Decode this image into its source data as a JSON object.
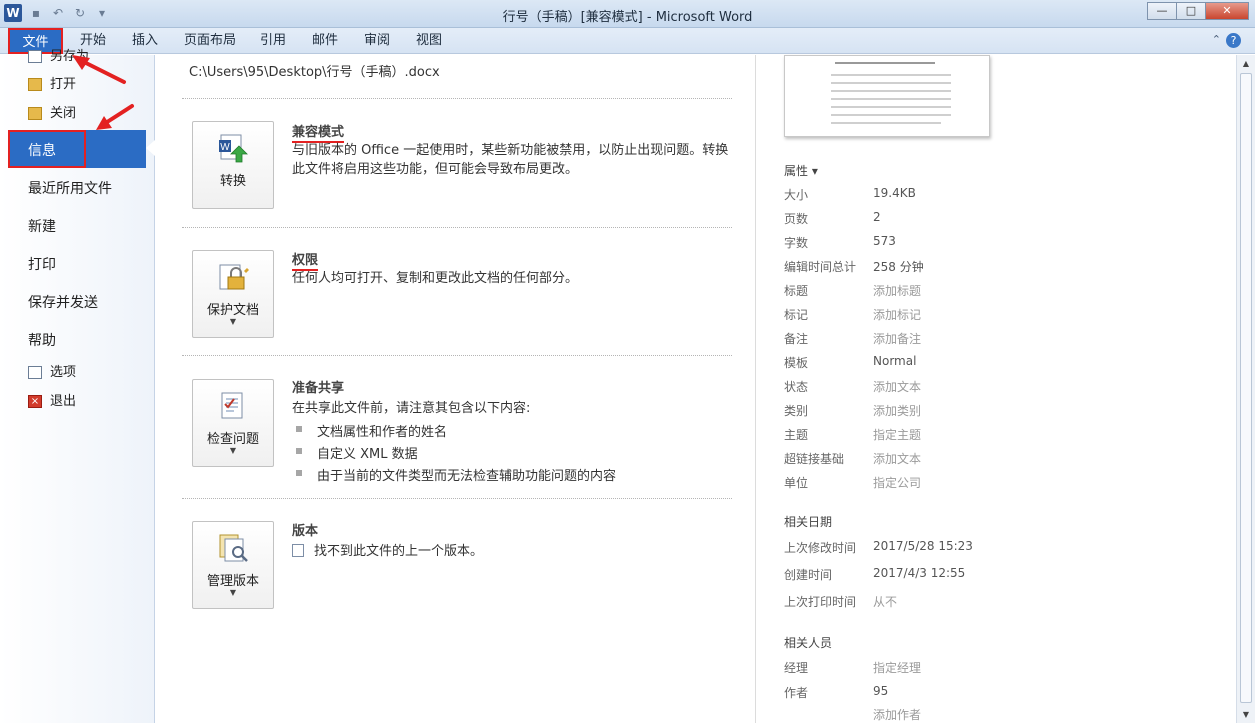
{
  "window": {
    "title": "行号（手稿）[兼容模式] - Microsoft Word",
    "logo": "W",
    "buttons": {
      "minimize": "—",
      "maximize": "□",
      "close": "✕"
    }
  },
  "ribbon": {
    "tabs": [
      "文件",
      "开始",
      "插入",
      "页面布局",
      "引用",
      "邮件",
      "审阅",
      "视图"
    ],
    "help": "?"
  },
  "nav": {
    "save_as": "另存为",
    "open": "打开",
    "close": "关闭",
    "info": "信息",
    "recent": "最近所用文件",
    "new": "新建",
    "print": "打印",
    "save_send": "保存并发送",
    "help": "帮助",
    "options": "选项",
    "exit": "退出"
  },
  "main": {
    "path": "C:\\Users\\95\\Desktop\\行号（手稿）.docx",
    "compat": {
      "button": "转换",
      "title": "兼容模式",
      "body": "与旧版本的 Office 一起使用时，某些新功能被禁用，以防止出现问题。转换此文件将启用这些功能，但可能会导致布局更改。"
    },
    "permissions": {
      "button": "保护文档",
      "title": "权限",
      "body": "任何人均可打开、复制和更改此文档的任何部分。"
    },
    "share": {
      "button": "检查问题",
      "title": "准备共享",
      "body": "在共享此文件前，请注意其包含以下内容:",
      "items": [
        "文档属性和作者的姓名",
        "自定义 XML 数据",
        "由于当前的文件类型而无法检查辅助功能问题的内容"
      ]
    },
    "versions": {
      "button": "管理版本",
      "title": "版本",
      "body": "找不到此文件的上一个版本。"
    }
  },
  "properties": {
    "header": "属性 ▾",
    "rows": [
      {
        "key": "大小",
        "value": "19.4KB",
        "placeholder": false
      },
      {
        "key": "页数",
        "value": "2",
        "placeholder": false
      },
      {
        "key": "字数",
        "value": "573",
        "placeholder": false
      },
      {
        "key": "编辑时间总计",
        "value": "258 分钟",
        "placeholder": false
      },
      {
        "key": "标题",
        "value": "添加标题",
        "placeholder": true
      },
      {
        "key": "标记",
        "value": "添加标记",
        "placeholder": true
      },
      {
        "key": "备注",
        "value": "添加备注",
        "placeholder": true
      },
      {
        "key": "模板",
        "value": "Normal",
        "placeholder": false
      },
      {
        "key": "状态",
        "value": "添加文本",
        "placeholder": true
      },
      {
        "key": "类别",
        "value": "添加类别",
        "placeholder": true
      },
      {
        "key": "主题",
        "value": "指定主题",
        "placeholder": true
      },
      {
        "key": "超链接基础",
        "value": "添加文本",
        "placeholder": true
      },
      {
        "key": "单位",
        "value": "指定公司",
        "placeholder": true
      }
    ],
    "dates_header": "相关日期",
    "dates": [
      {
        "key": "上次修改时间",
        "value": "2017/5/28 15:23",
        "placeholder": false
      },
      {
        "key": "创建时间",
        "value": "2017/4/3 12:55",
        "placeholder": false
      },
      {
        "key": "上次打印时间",
        "value": "从不",
        "placeholder": true
      }
    ],
    "people_header": "相关人员",
    "people": [
      {
        "key": "经理",
        "value": "指定经理",
        "placeholder": true
      },
      {
        "key": "作者",
        "value": "95",
        "placeholder": false
      },
      {
        "key": "",
        "value": "添加作者",
        "placeholder": true
      }
    ]
  },
  "colors": {
    "accent": "#2b6cc4",
    "annotation": "#e32121"
  }
}
